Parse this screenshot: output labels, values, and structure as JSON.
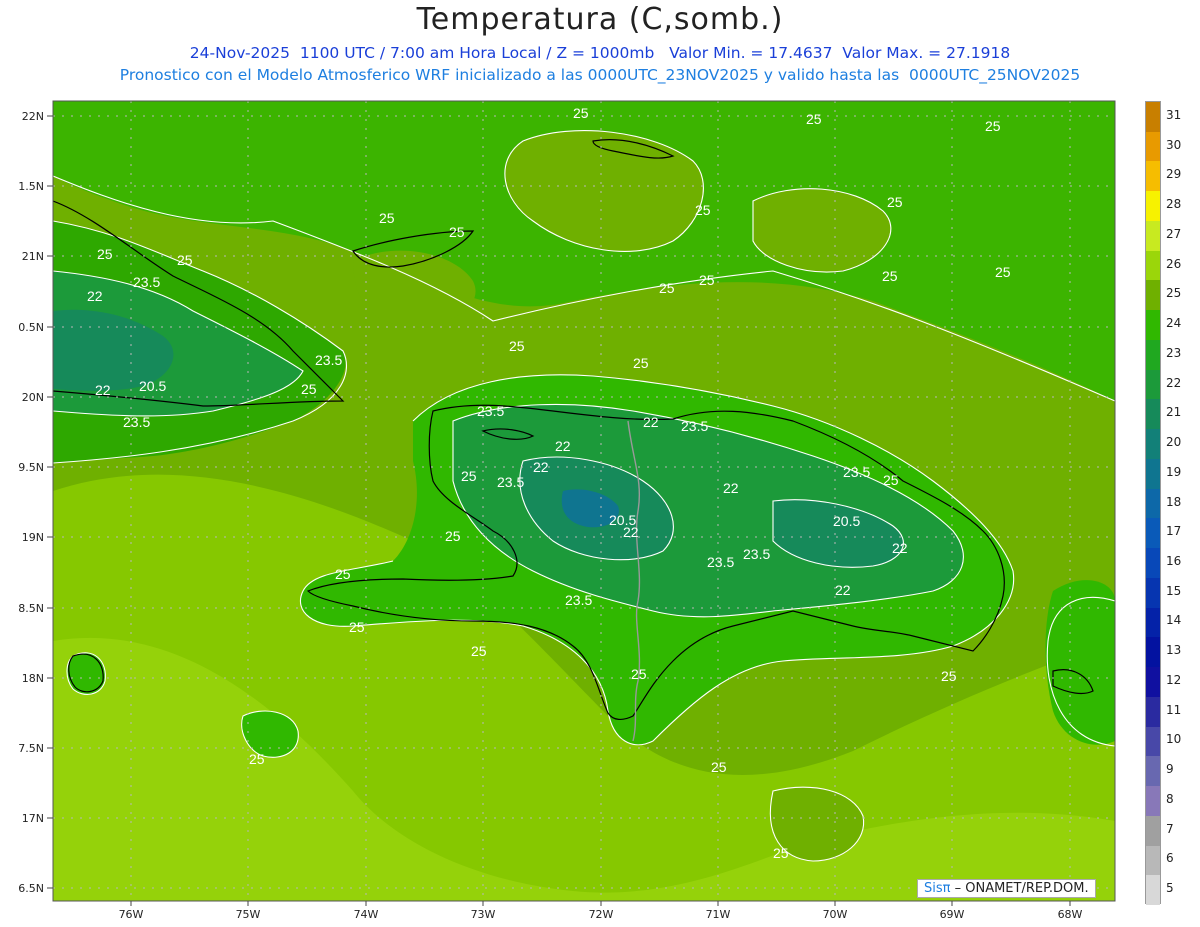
{
  "header": {
    "title": "Temperatura (C,somb.)",
    "line1": "24-Nov-2025  1100 UTC / 7:00 am Hora Local / Z = 1000mb   Valor Min. = 17.4637  Valor Max. = 27.1918",
    "line2": "Pronostico con el Modelo Atmosferico WRF inicializado a las 0000UTC_23NOV2025 y valido hasta las  0000UTC_25NOV2025"
  },
  "map": {
    "lat_ticks": [
      "22N",
      "21.5N",
      "21N",
      "20.5N",
      "20N",
      "19.5N",
      "19N",
      "18.5N",
      "18N",
      "17.5N",
      "17N",
      "16.5N"
    ],
    "lon_ticks": [
      "76W",
      "75W",
      "74W",
      "73W",
      "72W",
      "71W",
      "70W",
      "69W",
      "68W"
    ],
    "lat_labels_shown": [
      "22N",
      "1.5N",
      "21N",
      "0.5N",
      "20N",
      "9.5N",
      "19N",
      "8.5N",
      "18N",
      "7.5N",
      "17N",
      "6.5N"
    ],
    "contour_labels": [
      {
        "text": "25"
      },
      {
        "text": "25"
      },
      {
        "text": "25"
      },
      {
        "text": "25"
      },
      {
        "text": "25"
      },
      {
        "text": "25"
      },
      {
        "text": "25"
      },
      {
        "text": "25"
      },
      {
        "text": "25"
      },
      {
        "text": "25"
      },
      {
        "text": "25"
      },
      {
        "text": "25"
      },
      {
        "text": "25"
      },
      {
        "text": "25"
      },
      {
        "text": "25"
      },
      {
        "text": "25"
      },
      {
        "text": "25"
      },
      {
        "text": "25"
      },
      {
        "text": "25"
      },
      {
        "text": "25"
      },
      {
        "text": "25"
      },
      {
        "text": "25"
      },
      {
        "text": "25"
      },
      {
        "text": "25"
      },
      {
        "text": "25"
      },
      {
        "text": "25"
      },
      {
        "text": "25"
      },
      {
        "text": "23.5"
      },
      {
        "text": "23.5"
      },
      {
        "text": "23.5"
      },
      {
        "text": "23.5"
      },
      {
        "text": "23.5"
      },
      {
        "text": "23.5"
      },
      {
        "text": "23.5"
      },
      {
        "text": "23.5"
      },
      {
        "text": "23.5"
      },
      {
        "text": "23.5"
      },
      {
        "text": "22"
      },
      {
        "text": "22"
      },
      {
        "text": "22"
      },
      {
        "text": "22"
      },
      {
        "text": "22"
      },
      {
        "text": "22"
      },
      {
        "text": "22"
      },
      {
        "text": "22"
      },
      {
        "text": "22"
      },
      {
        "text": "20.5"
      },
      {
        "text": "20.5"
      },
      {
        "text": "20.5"
      }
    ]
  },
  "colorbar": {
    "labels": [
      "31",
      "30",
      "29",
      "28",
      "27",
      "26",
      "25",
      "24",
      "23",
      "22",
      "21",
      "20",
      "19",
      "18",
      "17",
      "16",
      "15",
      "14",
      "13",
      "12",
      "11",
      "10",
      "9",
      "8",
      "7",
      "6",
      "5"
    ],
    "colors": [
      "#c87f00",
      "#e89a00",
      "#f6bd00",
      "#f7f200",
      "#c8ea20",
      "#9bd60a",
      "#6fb000",
      "#30b800",
      "#20a820",
      "#1c9a3a",
      "#168a5a",
      "#128078",
      "#0f7590",
      "#0d68a8",
      "#0a5ab8",
      "#0848b8",
      "#0635b0",
      "#0422a8",
      "#0312a0",
      "#1010a0",
      "#2a2aa0",
      "#4848a8",
      "#6868b0",
      "#8878b8",
      "#a0a0a0",
      "#b8b8b8",
      "#d8d8d8"
    ]
  },
  "credit": {
    "logo": "Sisπ",
    "text": " – ONAMET/REP.DOM."
  }
}
